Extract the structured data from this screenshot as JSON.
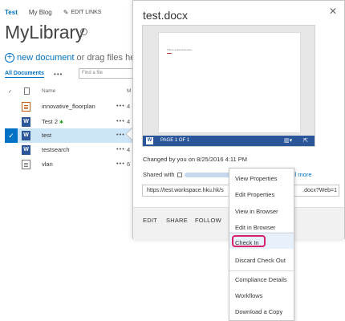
{
  "topnav": {
    "site": "Test",
    "blog": "My Blog",
    "edit_links": "EDIT LINKS"
  },
  "library": {
    "title": "MyLibrary",
    "info_glyph": "i",
    "new_document": "new document",
    "drag_hint": "or drag files he",
    "view_label": "All Documents",
    "view_menu": "•••",
    "find_placeholder": "Find a file"
  },
  "grid": {
    "header_check": "✓",
    "header_name": "Name",
    "header_more": "M",
    "rows": [
      {
        "name": "innovative_floorplan",
        "icon": "xml-file-icon",
        "dots": "•••",
        "trunc": "4",
        "new": ""
      },
      {
        "name": "Test 2",
        "icon": "word-file-icon",
        "dots": "•••",
        "trunc": "4",
        "new": "✱"
      },
      {
        "name": "test",
        "icon": "word-file-icon",
        "dots": "•••",
        "trunc": "",
        "new": "",
        "selected": true
      },
      {
        "name": "testsearch",
        "icon": "word-file-icon",
        "dots": "•••",
        "trunc": "4",
        "new": ""
      },
      {
        "name": "vlan",
        "icon": "text-file-icon",
        "dots": "•••",
        "trunc": "6",
        "new": ""
      }
    ],
    "selected_check": "✓",
    "word_glyph": "W"
  },
  "callout": {
    "title": "test.docx",
    "close_glyph": "✕",
    "preview_text": "This is a test document.",
    "page_indicator": "PAGE 1 OF 1",
    "changed": "Changed by you on 8/25/2016 4:11 PM",
    "shared_label": "Shared with",
    "shared_more": "ll more",
    "url": "https://test.workspace.hku.hk/s",
    "url_tail": ".docx?Web=1",
    "actions": {
      "edit": "EDIT",
      "share": "SHARE",
      "follow": "FOLLOW"
    }
  },
  "menu": {
    "items": [
      "View Properties",
      "Edit Properties",
      "View in Browser",
      "Edit in Browser",
      "Check In",
      "Discard Check Out",
      "Compliance Details",
      "Workflows",
      "Download a Copy"
    ],
    "highlighted": "Check In",
    "ring_color": "#d9226b"
  },
  "colors": {
    "accent": "#0072c6",
    "word": "#2b579a",
    "selection": "#cde6f7"
  }
}
